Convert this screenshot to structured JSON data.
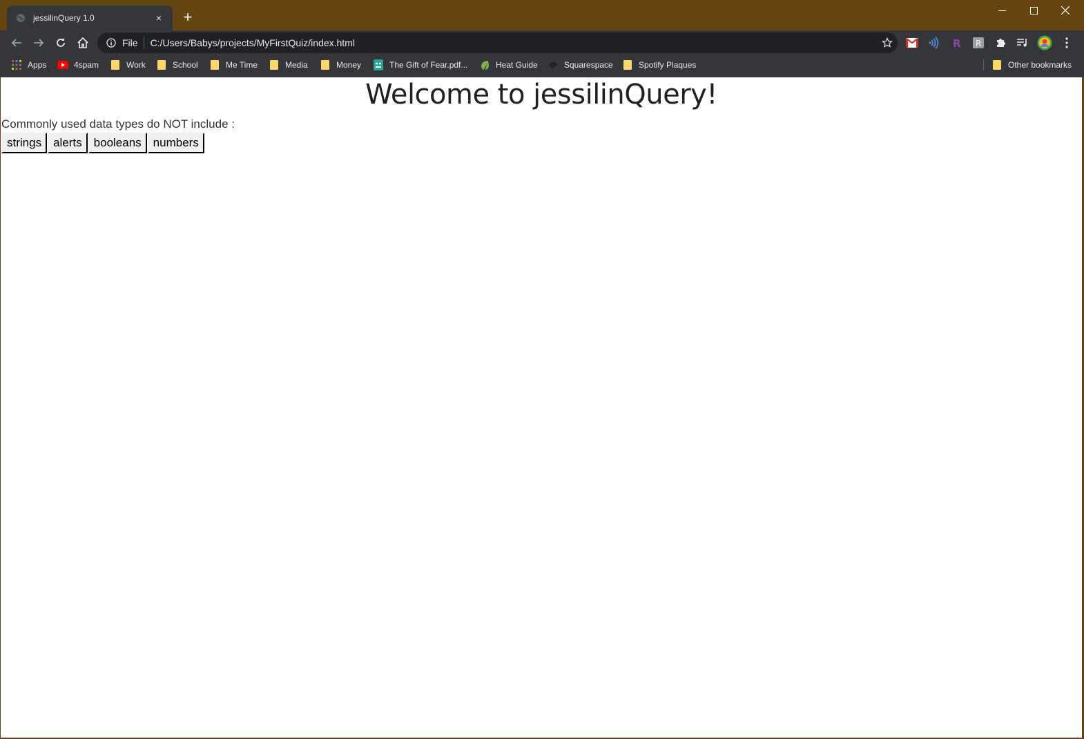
{
  "tab": {
    "title": "jessilinQuery 1.0",
    "close": "×"
  },
  "new_tab": "+",
  "omnibox": {
    "scheme": "File",
    "url": "C:/Users/Babys/projects/MyFirstQuiz/index.html"
  },
  "bookmarks": {
    "items": [
      {
        "label": "Apps",
        "icon": "apps-grid-icon"
      },
      {
        "label": "4spam",
        "icon": "youtube-icon"
      },
      {
        "label": "Work",
        "icon": "folder-icon"
      },
      {
        "label": "School",
        "icon": "folder-icon"
      },
      {
        "label": "Me Time",
        "icon": "folder-icon"
      },
      {
        "label": "Media",
        "icon": "folder-icon"
      },
      {
        "label": "Money",
        "icon": "folder-icon"
      },
      {
        "label": "The Gift of Fear.pdf...",
        "icon": "document-bot-icon"
      },
      {
        "label": "Heat Guide",
        "icon": "leaf-icon"
      },
      {
        "label": "Squarespace",
        "icon": "squarespace-icon"
      },
      {
        "label": "Spotify Plaques",
        "icon": "folder-icon"
      }
    ],
    "other": "Other bookmarks"
  },
  "page": {
    "heading": "Welcome to jessilinQuery!",
    "question": "Commonly used data types do NOT include :",
    "answers": [
      "strings",
      "alerts",
      "booleans",
      "numbers"
    ]
  },
  "colors": {
    "frame": "#654612",
    "toolbar": "#35363a",
    "omnibox": "#202124",
    "folder": "#fdd663"
  }
}
